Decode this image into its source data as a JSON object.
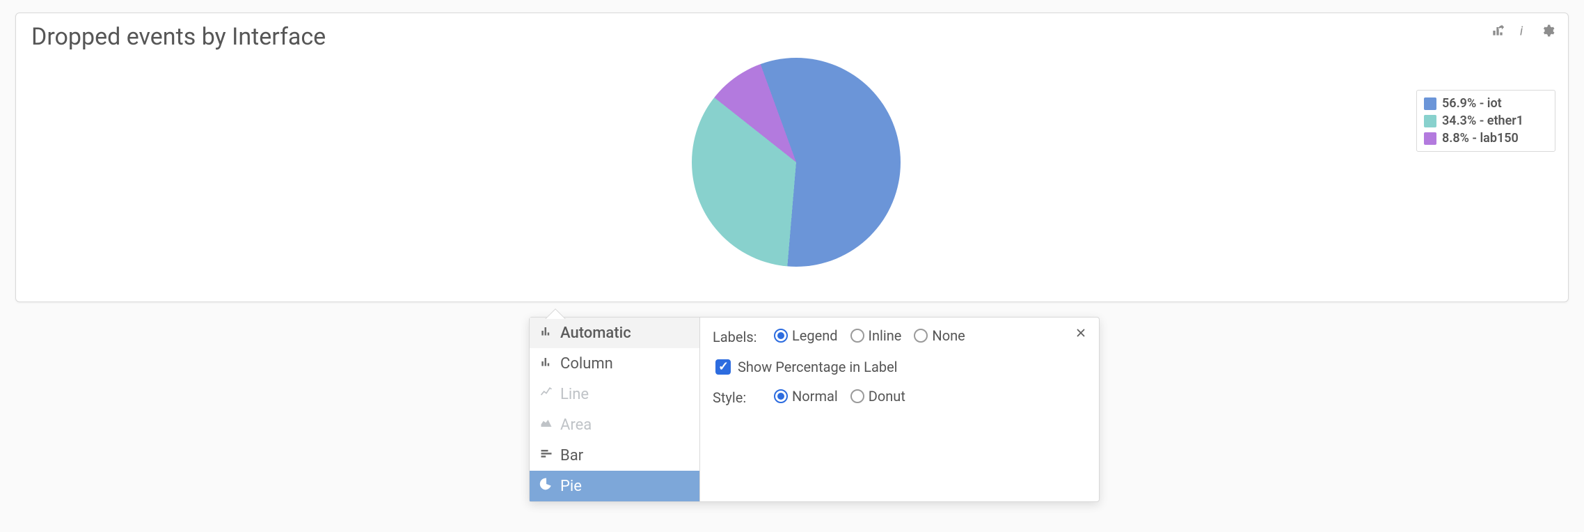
{
  "panel": {
    "title": "Dropped events by Interface",
    "actions": {
      "share_icon": "share",
      "info_icon": "info",
      "gear_icon": "settings"
    }
  },
  "chart_data": {
    "type": "pie",
    "title": "Dropped events by Interface",
    "series": [
      {
        "name": "iot",
        "percent": 56.9,
        "color": "#6b95d8"
      },
      {
        "name": "ether1",
        "percent": 34.3,
        "color": "#88d1cd"
      },
      {
        "name": "lab150",
        "percent": 8.8,
        "color": "#b37ade"
      }
    ],
    "legend": [
      "56.9% - iot",
      "34.3% - ether1",
      "8.8% - lab150"
    ],
    "style": "normal",
    "label_mode": "legend",
    "show_percentage": true
  },
  "popover": {
    "types": [
      {
        "id": "automatic",
        "label": "Automatic",
        "state": "header",
        "icon": "column"
      },
      {
        "id": "column",
        "label": "Column",
        "state": "normal",
        "icon": "column"
      },
      {
        "id": "line",
        "label": "Line",
        "state": "disabled",
        "icon": "line"
      },
      {
        "id": "area",
        "label": "Area",
        "state": "disabled",
        "icon": "area"
      },
      {
        "id": "bar",
        "label": "Bar",
        "state": "normal",
        "icon": "bar"
      },
      {
        "id": "pie",
        "label": "Pie",
        "state": "selected",
        "icon": "pie"
      }
    ],
    "labels_label": "Labels:",
    "labels_options": [
      "Legend",
      "Inline",
      "None"
    ],
    "labels_selected": "Legend",
    "show_pct_label": "Show Percentage in Label",
    "show_pct_checked": true,
    "style_label": "Style:",
    "style_options": [
      "Normal",
      "Donut"
    ],
    "style_selected": "Normal"
  }
}
